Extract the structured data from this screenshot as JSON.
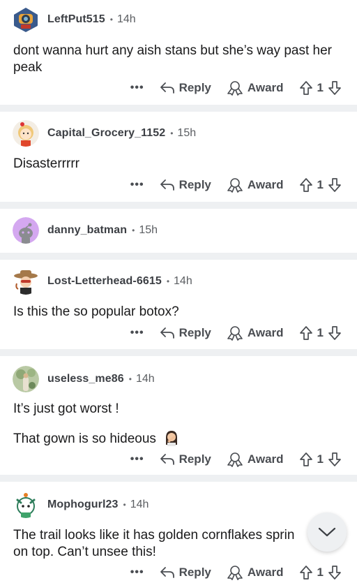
{
  "actions": {
    "more": "•••",
    "reply": "Reply",
    "award": "Award"
  },
  "comments": [
    {
      "username": "LeftPut515",
      "time": "14h",
      "body": [
        "dont wanna hurt any aish stans but she’s way past her peak"
      ],
      "votes": "1",
      "avatar": "avatar-robot-helmet"
    },
    {
      "username": "Capital_Grocery_1152",
      "time": "15h",
      "body": [
        "Disasterrrrr"
      ],
      "votes": "1",
      "avatar": "avatar-blonde-girl"
    },
    {
      "username": "danny_batman",
      "time": "15h",
      "body": [],
      "votes": "",
      "avatar": "avatar-default-snoo-purple"
    },
    {
      "username": "Lost-Letterhead-6615",
      "time": "14h",
      "body": [
        "Is this the so popular botox?"
      ],
      "votes": "1",
      "avatar": "avatar-cowboy-hat"
    },
    {
      "username": "useless_me86",
      "time": "14h",
      "body": [
        "It’s just got worst !",
        "That gown is so hideous"
      ],
      "emoji": "woman-facepalming-emoji",
      "votes": "1",
      "avatar": "avatar-photo-nature"
    },
    {
      "username": "Mophogurl23",
      "time": "14h",
      "body": [
        "The trail looks like it has golden cornflakes sprin on top. Can’t unsee this!"
      ],
      "votes": "1",
      "avatar": "avatar-green-dragon"
    }
  ],
  "colors": {
    "separator": "#eef0f2",
    "text": "#1a1a1b",
    "meta": "#5b5e62"
  }
}
